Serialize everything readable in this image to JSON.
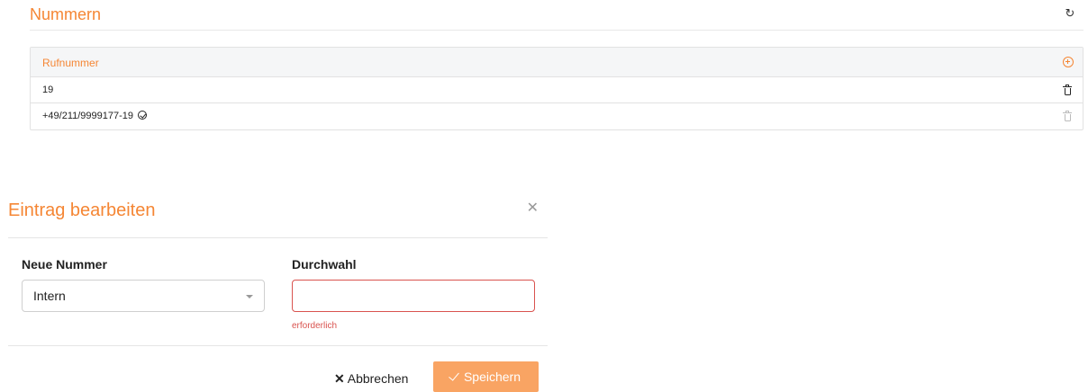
{
  "section": {
    "title": "Nummern"
  },
  "table": {
    "header": "Rufnummer",
    "rows": [
      {
        "number": "19",
        "verified": false,
        "delete_enabled": true
      },
      {
        "number": "+49/211/9999177-19",
        "verified": true,
        "delete_enabled": false
      }
    ]
  },
  "modal": {
    "title": "Eintrag bearbeiten",
    "new_number_label": "Neue Nummer",
    "new_number_value": "Intern",
    "extension_label": "Durchwahl",
    "extension_value": "",
    "extension_error": "erforderlich",
    "cancel_label": "Abbrechen",
    "save_label": "Speichern"
  },
  "colors": {
    "accent": "#f58634",
    "error": "#d9534f",
    "save_button": "#f9a463"
  },
  "icons": [
    "refresh-icon",
    "add-circle-icon",
    "trash-icon",
    "check-circle-icon",
    "close-icon",
    "caret-down-icon",
    "checkmark-icon"
  ]
}
